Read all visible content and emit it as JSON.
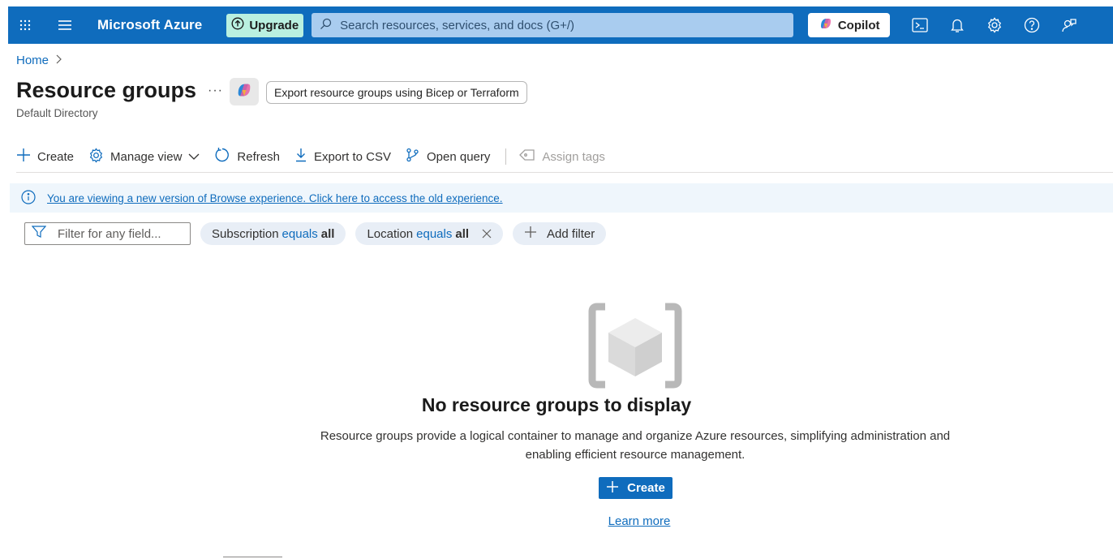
{
  "topbar": {
    "brand": "Microsoft Azure",
    "upgrade_label": "Upgrade",
    "search_placeholder": "Search resources, services, and docs (G+/)",
    "copilot_label": "Copilot",
    "bg_color": "#0f6cbd"
  },
  "breadcrumb": {
    "home": "Home"
  },
  "page": {
    "title": "Resource groups",
    "subtitle": "Default Directory",
    "more": "···",
    "export_label": "Export resource groups using Bicep or Terraform"
  },
  "toolbar": {
    "create": "Create",
    "manage_view": "Manage view",
    "refresh": "Refresh",
    "export_csv": "Export to CSV",
    "open_query": "Open query",
    "assign_tags": "Assign tags"
  },
  "banner": {
    "text": "You are viewing a new version of Browse experience. Click here to access the old experience."
  },
  "filters": {
    "placeholder": "Filter for any field...",
    "subscription": {
      "field": "Subscription",
      "op": "equals",
      "value": "all"
    },
    "location": {
      "field": "Location",
      "op": "equals",
      "value": "all"
    },
    "add_filter": "Add filter"
  },
  "empty_state": {
    "title": "No resource groups to display",
    "description": "Resource groups provide a logical container to manage and organize Azure resources, simplifying administration and enabling efficient resource management.",
    "create_label": "Create",
    "learn_more": "Learn more"
  }
}
